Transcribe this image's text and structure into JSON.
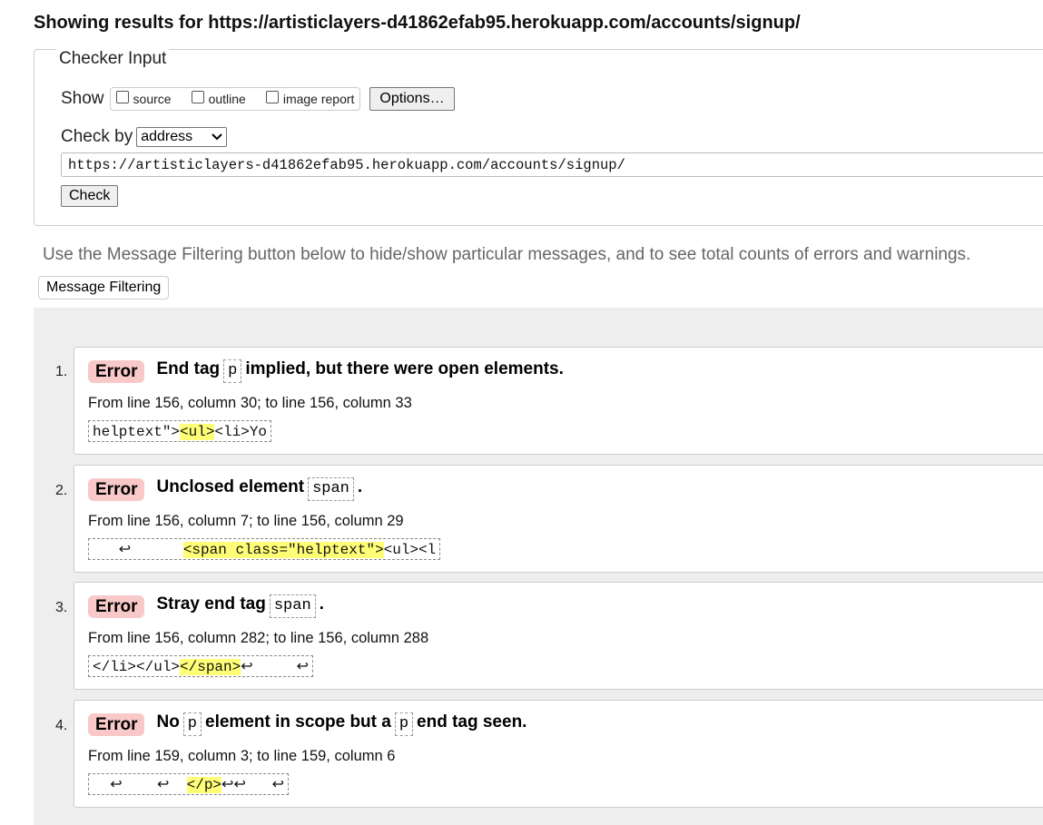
{
  "header": {
    "results_title": "Showing results for https://artisticlayers-d41862efab95.herokuapp.com/accounts/signup/"
  },
  "checker": {
    "legend": "Checker Input",
    "show_label": "Show",
    "show_options": [
      "source",
      "outline",
      "image report"
    ],
    "options_button": "Options…",
    "checkby_label": "Check by",
    "checkby_selected": "address",
    "url_value": "https://artisticlayers-d41862efab95.herokuapp.com/accounts/signup/",
    "check_button": "Check"
  },
  "filter": {
    "note": "Use the Message Filtering button below to hide/show particular messages, and to see total counts of errors and warnings.",
    "button": "Message Filtering"
  },
  "messages": [
    {
      "num": "1.",
      "type": "Error",
      "text_before": "End tag",
      "code": "p",
      "text_after": "implied, but there were open elements.",
      "location": "From line 156, column 30; to line 156, column 33",
      "extract_before": "helptext\">",
      "extract_hl": "<ul>",
      "extract_after": "<li>Yo"
    },
    {
      "num": "2.",
      "type": "Error",
      "text_before": "Unclosed element",
      "code": "span",
      "text_after": ".",
      "location": "From line 156, column 7; to line 156, column 29",
      "extract_before": "   ↩      ",
      "extract_hl": "<span class=\"helptext\">",
      "extract_after": "<ul><l"
    },
    {
      "num": "3.",
      "type": "Error",
      "text_before": "Stray end tag",
      "code": "span",
      "text_after": ".",
      "location": "From line 156, column 282; to line 156, column 288",
      "extract_before": "</li></ul>",
      "extract_hl": "</span>",
      "extract_after": "↩     ↩"
    },
    {
      "num": "4.",
      "type": "Error",
      "text_before": "No",
      "code": "p",
      "text_mid": "element in scope but a",
      "code2": "p",
      "text_after": "end tag seen.",
      "location": "From line 159, column 3; to line 159, column 6",
      "extract_before": "  ↩    ↩  ",
      "extract_hl": "</p>",
      "extract_after": "↩↩   ↩"
    }
  ]
}
